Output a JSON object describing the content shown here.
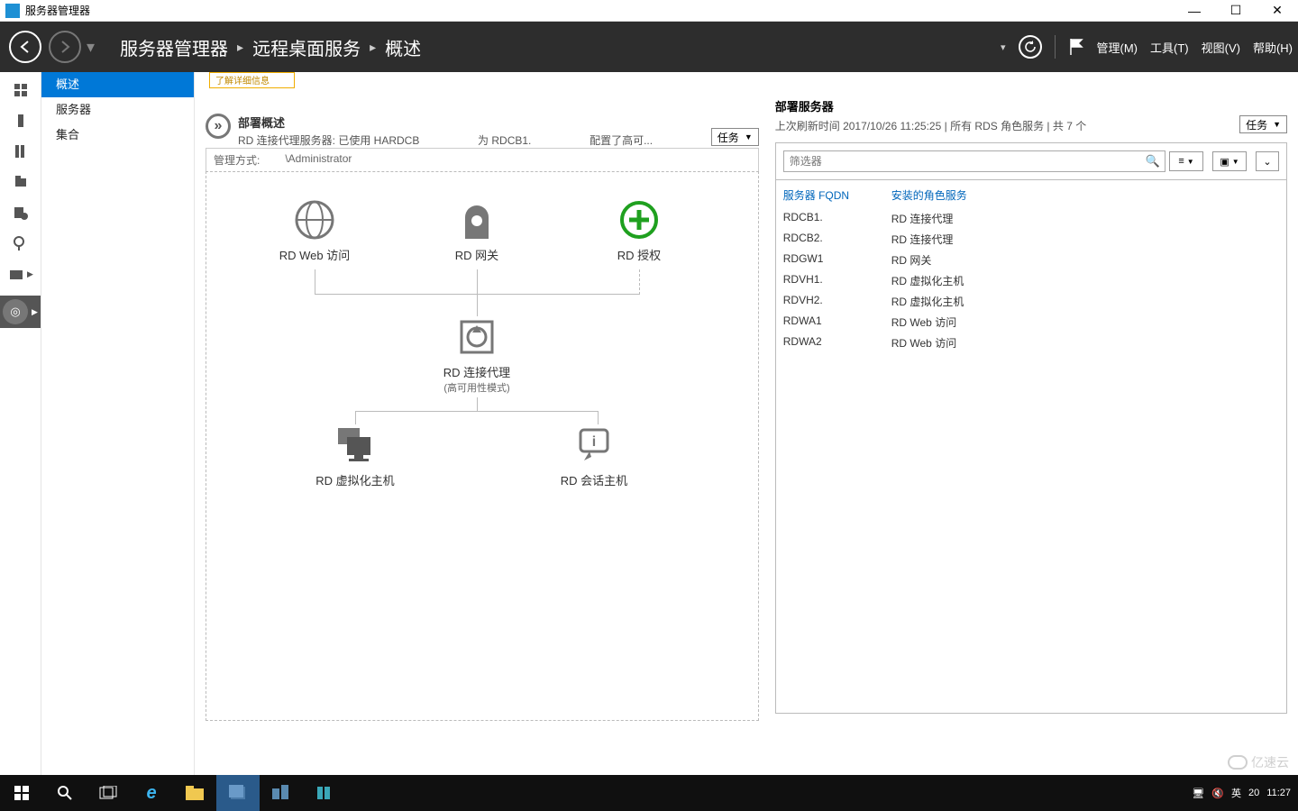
{
  "window": {
    "title": "服务器管理器",
    "min": "—",
    "max": "☐",
    "close": "✕"
  },
  "header": {
    "crumb1": "服务器管理器",
    "crumb2": "远程桌面服务",
    "crumb3": "概述",
    "sep": "▸",
    "menu_manage": "管理(M)",
    "menu_tools": "工具(T)",
    "menu_view": "视图(V)",
    "menu_help": "帮助(H)"
  },
  "sidebar": {
    "items": [
      "概述",
      "服务器",
      "集合"
    ]
  },
  "notice": "了解详细信息",
  "deploy_overview": {
    "circle": "»",
    "title": "部署概述",
    "subtitle_a": "RD 连接代理服务器: 已使用 HARDCB",
    "subtitle_b": "为 RDCB1.",
    "subtitle_c": "配置了高可...",
    "tasks": "任务",
    "meta_a": "管理方式:",
    "meta_b": "\\Administrator"
  },
  "nodes": {
    "web": "RD Web 访问",
    "gateway": "RD 网关",
    "license": "RD 授权",
    "broker": "RD 连接代理",
    "broker_sub": "(高可用性模式)",
    "virt": "RD 虚拟化主机",
    "session": "RD 会话主机"
  },
  "deploy_servers": {
    "title": "部署服务器",
    "status": "上次刷新时间 2017/10/26 11:25:25 | 所有 RDS 角色服务  | 共 7 个",
    "tasks": "任务",
    "filter_ph": "筛选器",
    "th1": "服务器 FQDN",
    "th2": "安装的角色服务",
    "rows": [
      {
        "fqdn": "RDCB1.",
        "role": "RD 连接代理"
      },
      {
        "fqdn": "RDCB2.",
        "role": "RD 连接代理"
      },
      {
        "fqdn": "RDGW1",
        "role": "RD 网关"
      },
      {
        "fqdn": "RDVH1.",
        "role": "RD 虚拟化主机"
      },
      {
        "fqdn": "RDVH2.",
        "role": "RD 虚拟化主机"
      },
      {
        "fqdn": "RDWA1",
        "role": "RD Web 访问"
      },
      {
        "fqdn": "RDWA2",
        "role": "RD Web 访问"
      }
    ]
  },
  "tray": {
    "ime": "英",
    "ime2": "20",
    "time": "11:27"
  },
  "watermark": "亿速云"
}
